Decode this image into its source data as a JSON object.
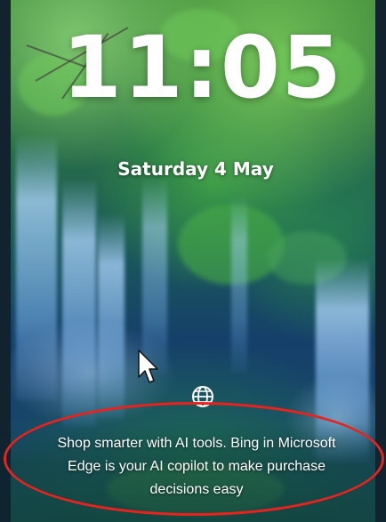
{
  "lockscreen": {
    "time": "11:05",
    "date": "Saturday 4 May",
    "spotlight_caption": "Shop smarter with AI tools. Bing in Microsoft Edge is your AI copilot to make purchase decisions easy",
    "icons": {
      "globe": "globe-icon",
      "cursor": "mouse-pointer-icon"
    }
  },
  "colors": {
    "annotation": "#e8231d",
    "text": "#ffffff"
  }
}
